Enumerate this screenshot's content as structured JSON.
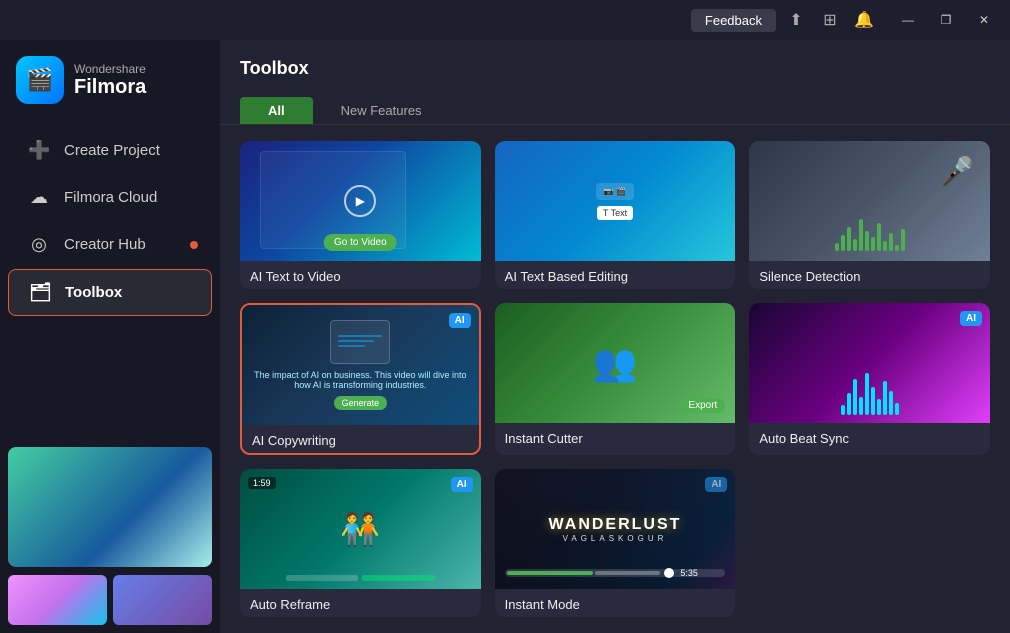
{
  "titlebar": {
    "feedback_label": "Feedback",
    "minimize_label": "—",
    "maximize_label": "❐",
    "close_label": "✕"
  },
  "sidebar": {
    "logo_brand": "Wondershare",
    "logo_product": "Filmora",
    "nav": [
      {
        "id": "create-project",
        "label": "Create Project",
        "icon": "➕",
        "dot": false
      },
      {
        "id": "filmora-cloud",
        "label": "Filmora Cloud",
        "icon": "☁",
        "dot": false
      },
      {
        "id": "creator-hub",
        "label": "Creator Hub",
        "icon": "◎",
        "dot": true
      },
      {
        "id": "toolbox",
        "label": "Toolbox",
        "icon": "🗂",
        "dot": false,
        "active": true
      }
    ]
  },
  "content": {
    "title": "Toolbox",
    "tabs": [
      {
        "id": "all",
        "label": "All",
        "active": true
      },
      {
        "id": "new-features",
        "label": "New Features",
        "active": false
      }
    ],
    "tools": [
      {
        "id": "ai-text-to-video",
        "label": "AI Text to Video",
        "ai_badge": false,
        "selected": false
      },
      {
        "id": "ai-text-based-editing",
        "label": "AI Text Based Editing",
        "ai_badge": false,
        "selected": false
      },
      {
        "id": "silence-detection",
        "label": "Silence Detection",
        "ai_badge": false,
        "selected": false
      },
      {
        "id": "ai-copywriting",
        "label": "AI Copywriting",
        "ai_badge": true,
        "selected": true
      },
      {
        "id": "instant-cutter",
        "label": "Instant Cutter",
        "ai_badge": false,
        "selected": false
      },
      {
        "id": "auto-beat-sync",
        "label": "Auto Beat Sync",
        "ai_badge": true,
        "selected": false
      },
      {
        "id": "auto-reframe",
        "label": "Auto Reframe",
        "ai_badge": true,
        "selected": false
      },
      {
        "id": "instant-mode",
        "label": "Instant Mode",
        "ai_badge": true,
        "selected": false
      }
    ],
    "go_to_video_label": "Go to Video",
    "export_label": "Export",
    "reframe_time": "1:59",
    "wanderlust_title": "WANDERLUST",
    "wanderlust_sub": "VAGLASKOGUR",
    "ai_badge_label": "AI",
    "time_label": "5:35"
  }
}
